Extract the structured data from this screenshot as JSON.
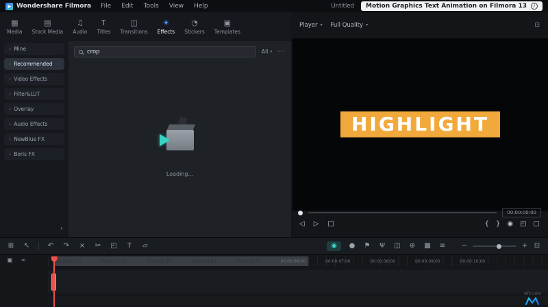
{
  "colors": {
    "accent_blue": "#4E8EF7",
    "accent_teal": "#3BD6C6",
    "playhead_red": "#F0524B",
    "banner_orange": "#F2A93C"
  },
  "ui": {
    "chevron_down": "▾"
  },
  "menubar": {
    "app_title": "Wondershare Filmora",
    "menus": [
      "File",
      "Edit",
      "Tools",
      "View",
      "Help"
    ],
    "project_name": "Untitled",
    "notification": "Motion Graphics Text Animation on Filmora 13"
  },
  "tabs": {
    "items": [
      {
        "label": "Media",
        "glyph": "▦"
      },
      {
        "label": "Stock Media",
        "glyph": "▤"
      },
      {
        "label": "Audio",
        "glyph": "♫"
      },
      {
        "label": "Titles",
        "glyph": "T"
      },
      {
        "label": "Transitions",
        "glyph": "◫"
      },
      {
        "label": "Effects",
        "glyph": "✦"
      },
      {
        "label": "Stickers",
        "glyph": "◔"
      },
      {
        "label": "Templates",
        "glyph": "▣"
      }
    ]
  },
  "sidebar": {
    "chevron_glyph": "›",
    "collapse_glyph": "‹",
    "items": [
      {
        "label": "Mine"
      },
      {
        "label": "Recommended"
      },
      {
        "label": "Video Effects"
      },
      {
        "label": "Filter&LUT"
      },
      {
        "label": "Overlay"
      },
      {
        "label": "Audio Effects"
      },
      {
        "label": "NewBlue FX"
      },
      {
        "label": "Boris FX"
      }
    ]
  },
  "effects_panel": {
    "search_value": "crop",
    "filter_label": "All",
    "more_glyph": "···",
    "loading_text": "Loading..."
  },
  "player": {
    "label": "Player",
    "quality": "Full Quality",
    "expand_glyph": "⊡",
    "banner_text": "HIGHLIGHT",
    "time_display": "00:00:00:00",
    "transport_left": [
      {
        "name": "previous-frame",
        "glyph": "◁"
      },
      {
        "name": "play",
        "glyph": "▷"
      },
      {
        "name": "stop",
        "glyph": "□"
      }
    ],
    "transport_right": [
      {
        "name": "mark-in",
        "glyph": "{"
      },
      {
        "name": "mark-out",
        "glyph": "}"
      },
      {
        "name": "snapshot",
        "glyph": "◉"
      },
      {
        "name": "crop-preview",
        "glyph": "◰"
      },
      {
        "name": "fullscreen",
        "glyph": "▢"
      }
    ]
  },
  "toolbar": {
    "left": [
      {
        "name": "layout",
        "glyph": "⊞"
      },
      {
        "name": "select",
        "glyph": "↖"
      },
      {
        "name": "undo",
        "glyph": "↶"
      },
      {
        "name": "redo",
        "glyph": "↷"
      },
      {
        "name": "delete",
        "glyph": "×"
      },
      {
        "name": "split",
        "glyph": "✂"
      },
      {
        "name": "crop",
        "glyph": "◰"
      },
      {
        "name": "add-text",
        "glyph": "T"
      },
      {
        "name": "clone",
        "glyph": "▱"
      }
    ],
    "right": [
      {
        "name": "render-preview",
        "glyph": "◉"
      },
      {
        "name": "record",
        "glyph": "●"
      },
      {
        "name": "marker",
        "glyph": "⚑"
      },
      {
        "name": "voiceover",
        "glyph": "Ψ"
      },
      {
        "name": "split-screen",
        "glyph": "◫"
      },
      {
        "name": "motion-track",
        "glyph": "⊕"
      },
      {
        "name": "chroma-key",
        "glyph": "▩"
      },
      {
        "name": "list-view",
        "glyph": "≡"
      }
    ],
    "zoom_out": "−",
    "zoom_in": "+",
    "fit": "⊡"
  },
  "timeline": {
    "gutter": [
      {
        "name": "manage-tracks",
        "glyph": "▣"
      },
      {
        "name": "track-link",
        "glyph": "∞"
      }
    ],
    "ruler_labels": [
      "00:00:01:00",
      "00:00:02:00",
      "00:00:03:00",
      "00:00:04:00",
      "00:00:05:00",
      "00:00:06:00",
      "00:00:07:00",
      "00:00:08:00",
      "00:00:09:00",
      "00:00:10:00"
    ]
  },
  "watermark": {
    "text": "wfx.com"
  }
}
